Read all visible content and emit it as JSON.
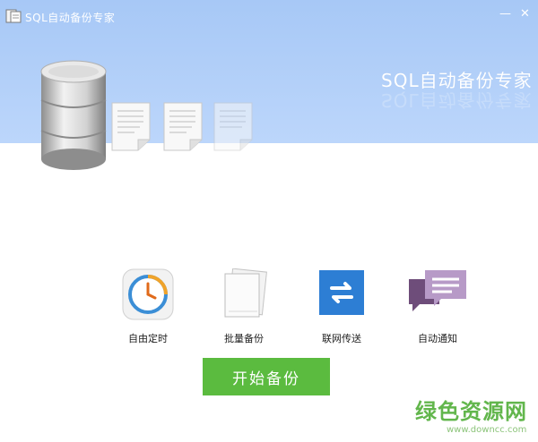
{
  "window": {
    "title": "SQL自动备份专家",
    "minimize_glyph": "—",
    "close_glyph": "✕"
  },
  "banner": {
    "title": "SQL自动备份专家"
  },
  "features": [
    {
      "label": "自由定时",
      "icon": "clock-icon"
    },
    {
      "label": "批量备份",
      "icon": "documents-icon"
    },
    {
      "label": "联网传送",
      "icon": "transfer-arrows-icon"
    },
    {
      "label": "自动通知",
      "icon": "chat-bubbles-icon"
    }
  ],
  "start_button": {
    "label": "开始备份"
  },
  "watermark": {
    "text": "绿色资源网",
    "url": "www.downcc.com"
  },
  "colors": {
    "header_blue": "#a7c8f6",
    "start_green": "#5bbb3f",
    "watermark_green": "#62b64c"
  }
}
